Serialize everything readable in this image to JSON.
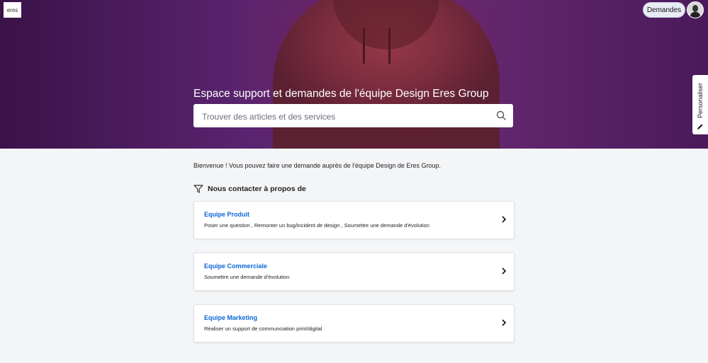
{
  "header": {
    "logo_text": "eres",
    "requests_label": "Demandes"
  },
  "hero": {
    "title": "Espace support et demandes de l'équipe Design Eres Group",
    "search_placeholder": "Trouver des articles et des services"
  },
  "sidebar_tab": {
    "label": "Personaliser"
  },
  "main": {
    "welcome": "Bienvenue ! Vous pouvez faire une demande auprès de l'équipe Design de Eres Group.",
    "section_title": "Nous contacter à propos de",
    "cards": [
      {
        "title": "Equipe Produit",
        "description": "Poser une question , Remonter un bug/incident de design , Soumettre une demande d'évolution"
      },
      {
        "title": "Equipe Commerciale",
        "description": "Soumettre une demande d'évolution"
      },
      {
        "title": "Equipe Marketing",
        "description": "Réaliser un support de communciation print/digital"
      }
    ]
  },
  "colors": {
    "accent": "#0b66d6",
    "hero_bg": "#5a2470"
  },
  "icons": [
    "search-icon",
    "filter-icon",
    "chevron-right-icon",
    "pencil-icon"
  ]
}
